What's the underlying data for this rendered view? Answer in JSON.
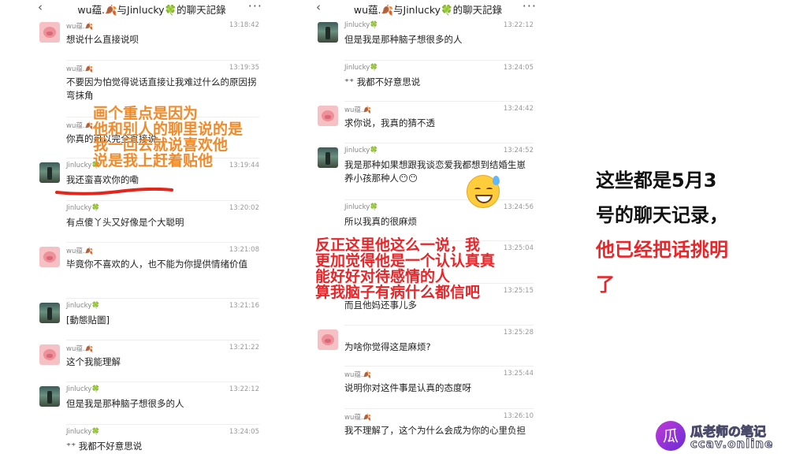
{
  "left": {
    "title": "wu蕴.🍂与Jinlucky🍀的聊天記錄",
    "back": "‹",
    "more": "···",
    "messages": [
      {
        "name": "wu蕴.🍂",
        "time": "13:18:42",
        "text": "想说什么直接说呗",
        "avatar": "pig"
      },
      {
        "name": "wu蕴.🍂",
        "time": "13:19:35",
        "text": "不要因为怕觉得说话直接让我难过什么的原因拐弯抹角",
        "avatar": "none"
      },
      {
        "name": "wu蕴.🍂",
        "time": "",
        "text": "你真的可以完全直接说",
        "avatar": "none"
      },
      {
        "name": "Jinlucky🍀",
        "time": "13:19:44",
        "text": "我还蛮喜欢你的嘞",
        "avatar": "photo"
      },
      {
        "name": "Jinlucky🍀",
        "time": "13:20:02",
        "text": "有点傻丫头又好像是个大聪明",
        "avatar": "none"
      },
      {
        "name": "wu蕴.🍂",
        "time": "13:21:08",
        "text": "毕竟你不喜欢的人，也不能为你提供情绪价值",
        "avatar": "pig"
      },
      {
        "name": "Jinlucky🍀",
        "time": "13:21:16",
        "text": "[動態貼圖]",
        "avatar": "photo"
      },
      {
        "name": "wu蕴.🍂",
        "time": "13:21:22",
        "text": "这个我能理解",
        "avatar": "pig"
      },
      {
        "name": "Jinlucky🍀",
        "time": "13:22:12",
        "text": "但是我是那种脑子想很多的人",
        "avatar": "photo"
      },
      {
        "name": "Jinlucky🍀",
        "time": "13:24:05",
        "text": "⁺⁺ 我都不好意思说",
        "avatar": "none"
      }
    ]
  },
  "right": {
    "title": "wu蕴.🍂与Jinlucky🍀的聊天記錄",
    "back": "‹",
    "more": "···",
    "messages": [
      {
        "name": "Jinlucky🍀",
        "time": "13:22:12",
        "text": "但是我是那种脑子想很多的人",
        "avatar": "photo"
      },
      {
        "name": "Jinlucky🍀",
        "time": "13:24:05",
        "text": "⁺⁺ 我都不好意思说",
        "avatar": "none"
      },
      {
        "name": "wu蕴.🍂",
        "time": "13:24:42",
        "text": "求你说，我真的猜不透",
        "avatar": "pig"
      },
      {
        "name": "Jinlucky🍀",
        "time": "13:24:52",
        "text": "我是那种如果想跟我谈恋爱我都想到结婚生崽养小孩那种人😶😶",
        "avatar": "photo"
      },
      {
        "name": "Jinlucky🍀",
        "time": "13:24:56",
        "text": "所以我真的很麻烦",
        "avatar": "none"
      },
      {
        "name": "",
        "time": "13:25:04",
        "text": "",
        "avatar": "none"
      },
      {
        "name": "",
        "time": "13:25:15",
        "text": "而且他妈还事儿多",
        "avatar": "none"
      },
      {
        "name": "",
        "time": "13:25:28",
        "text": "为啥你觉得这是麻烦?",
        "avatar": "pig"
      },
      {
        "name": "wu蕴.🍂",
        "time": "13:25:44",
        "text": "说明你对这件事是认真的态度呀",
        "avatar": "none"
      },
      {
        "name": "wu蕴.🍂",
        "time": "13:26:10",
        "text": "我不理解了，这个为什么会成为你的心里负担",
        "avatar": "none"
      }
    ]
  },
  "annotations": {
    "left": "画个重点是因为\n他和别人的聊里说的是\n我一回去就说喜欢他\n说是我上赶着贴他",
    "right": "反正这里他这么一说，我\n更加觉得他是一个认认真真\n能好好对待感情的人\n算我脑子有病什么都信吧"
  },
  "side_note": {
    "line1": "这些都是5月3",
    "line2": "号的聊天记录，",
    "line3": "他已经把话挑明",
    "line4": "了"
  },
  "watermark": {
    "logo": "瓜",
    "line1": "瓜老师の笔记",
    "line2": "ccav.online"
  },
  "colors": {
    "annotation_orange": "#f08a2a",
    "annotation_red": "#e8262a",
    "underline_red": "#e1261c"
  }
}
